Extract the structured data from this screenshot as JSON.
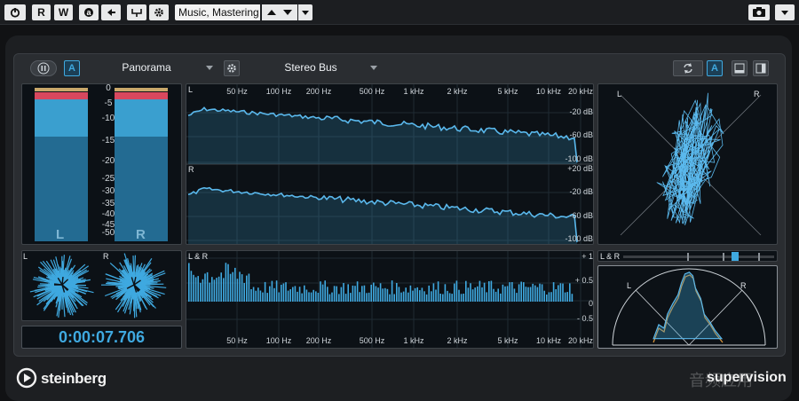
{
  "toolbar": {
    "power_label": "",
    "read_label": "R",
    "write_label": "W",
    "preset_name": "Music, Mastering"
  },
  "header": {
    "view_select": "Panorama",
    "channel_select": "Stereo Bus",
    "a_label": "A"
  },
  "meter": {
    "scale": [
      "0",
      "-5",
      "-10",
      "-15",
      "-20",
      "-25",
      "-30",
      "-35",
      "-40",
      "-45",
      "-50"
    ],
    "left_label": "L",
    "right_label": "R"
  },
  "spectrum": {
    "freq_labels": [
      "50 Hz",
      "100 Hz",
      "200 Hz",
      "500 Hz",
      "1 kHz",
      "2 kHz",
      "5 kHz",
      "10 kHz",
      "20 kHz"
    ],
    "db_labels_top": [
      "-20 dB",
      "-60 dB",
      "-100 dB"
    ],
    "db_labels_bottom": [
      "+20 dB",
      "-20 dB",
      "-60 dB",
      "-100 dB"
    ],
    "left_label": "L",
    "right_label": "R"
  },
  "correlation": {
    "label": "L & R",
    "scale": [
      "+ 1",
      "+ 0.5",
      "0",
      "- 0.5"
    ],
    "freq_labels": [
      "50 Hz",
      "100 Hz",
      "200 Hz",
      "500 Hz",
      "1 kHz",
      "2 kHz",
      "5 kHz",
      "10 kHz",
      "20 kHz"
    ]
  },
  "vectorscope": {
    "left_label": "L",
    "right_label": "R"
  },
  "balance": {
    "label": "L & R",
    "balance_position": 0.6
  },
  "panorama": {
    "left_label": "L",
    "right_label": "R"
  },
  "phase": {
    "left_label": "L",
    "right_label": "R"
  },
  "transport": {
    "timecode": "0:00:07.706"
  },
  "footer": {
    "brand": "steinberg",
    "product": "supervision",
    "watermark": "音频应用"
  },
  "colors": {
    "accent": "#3fa9e0",
    "meter": "#3a9fcf",
    "warn": "#d8485e",
    "panel": "#0c1116"
  }
}
